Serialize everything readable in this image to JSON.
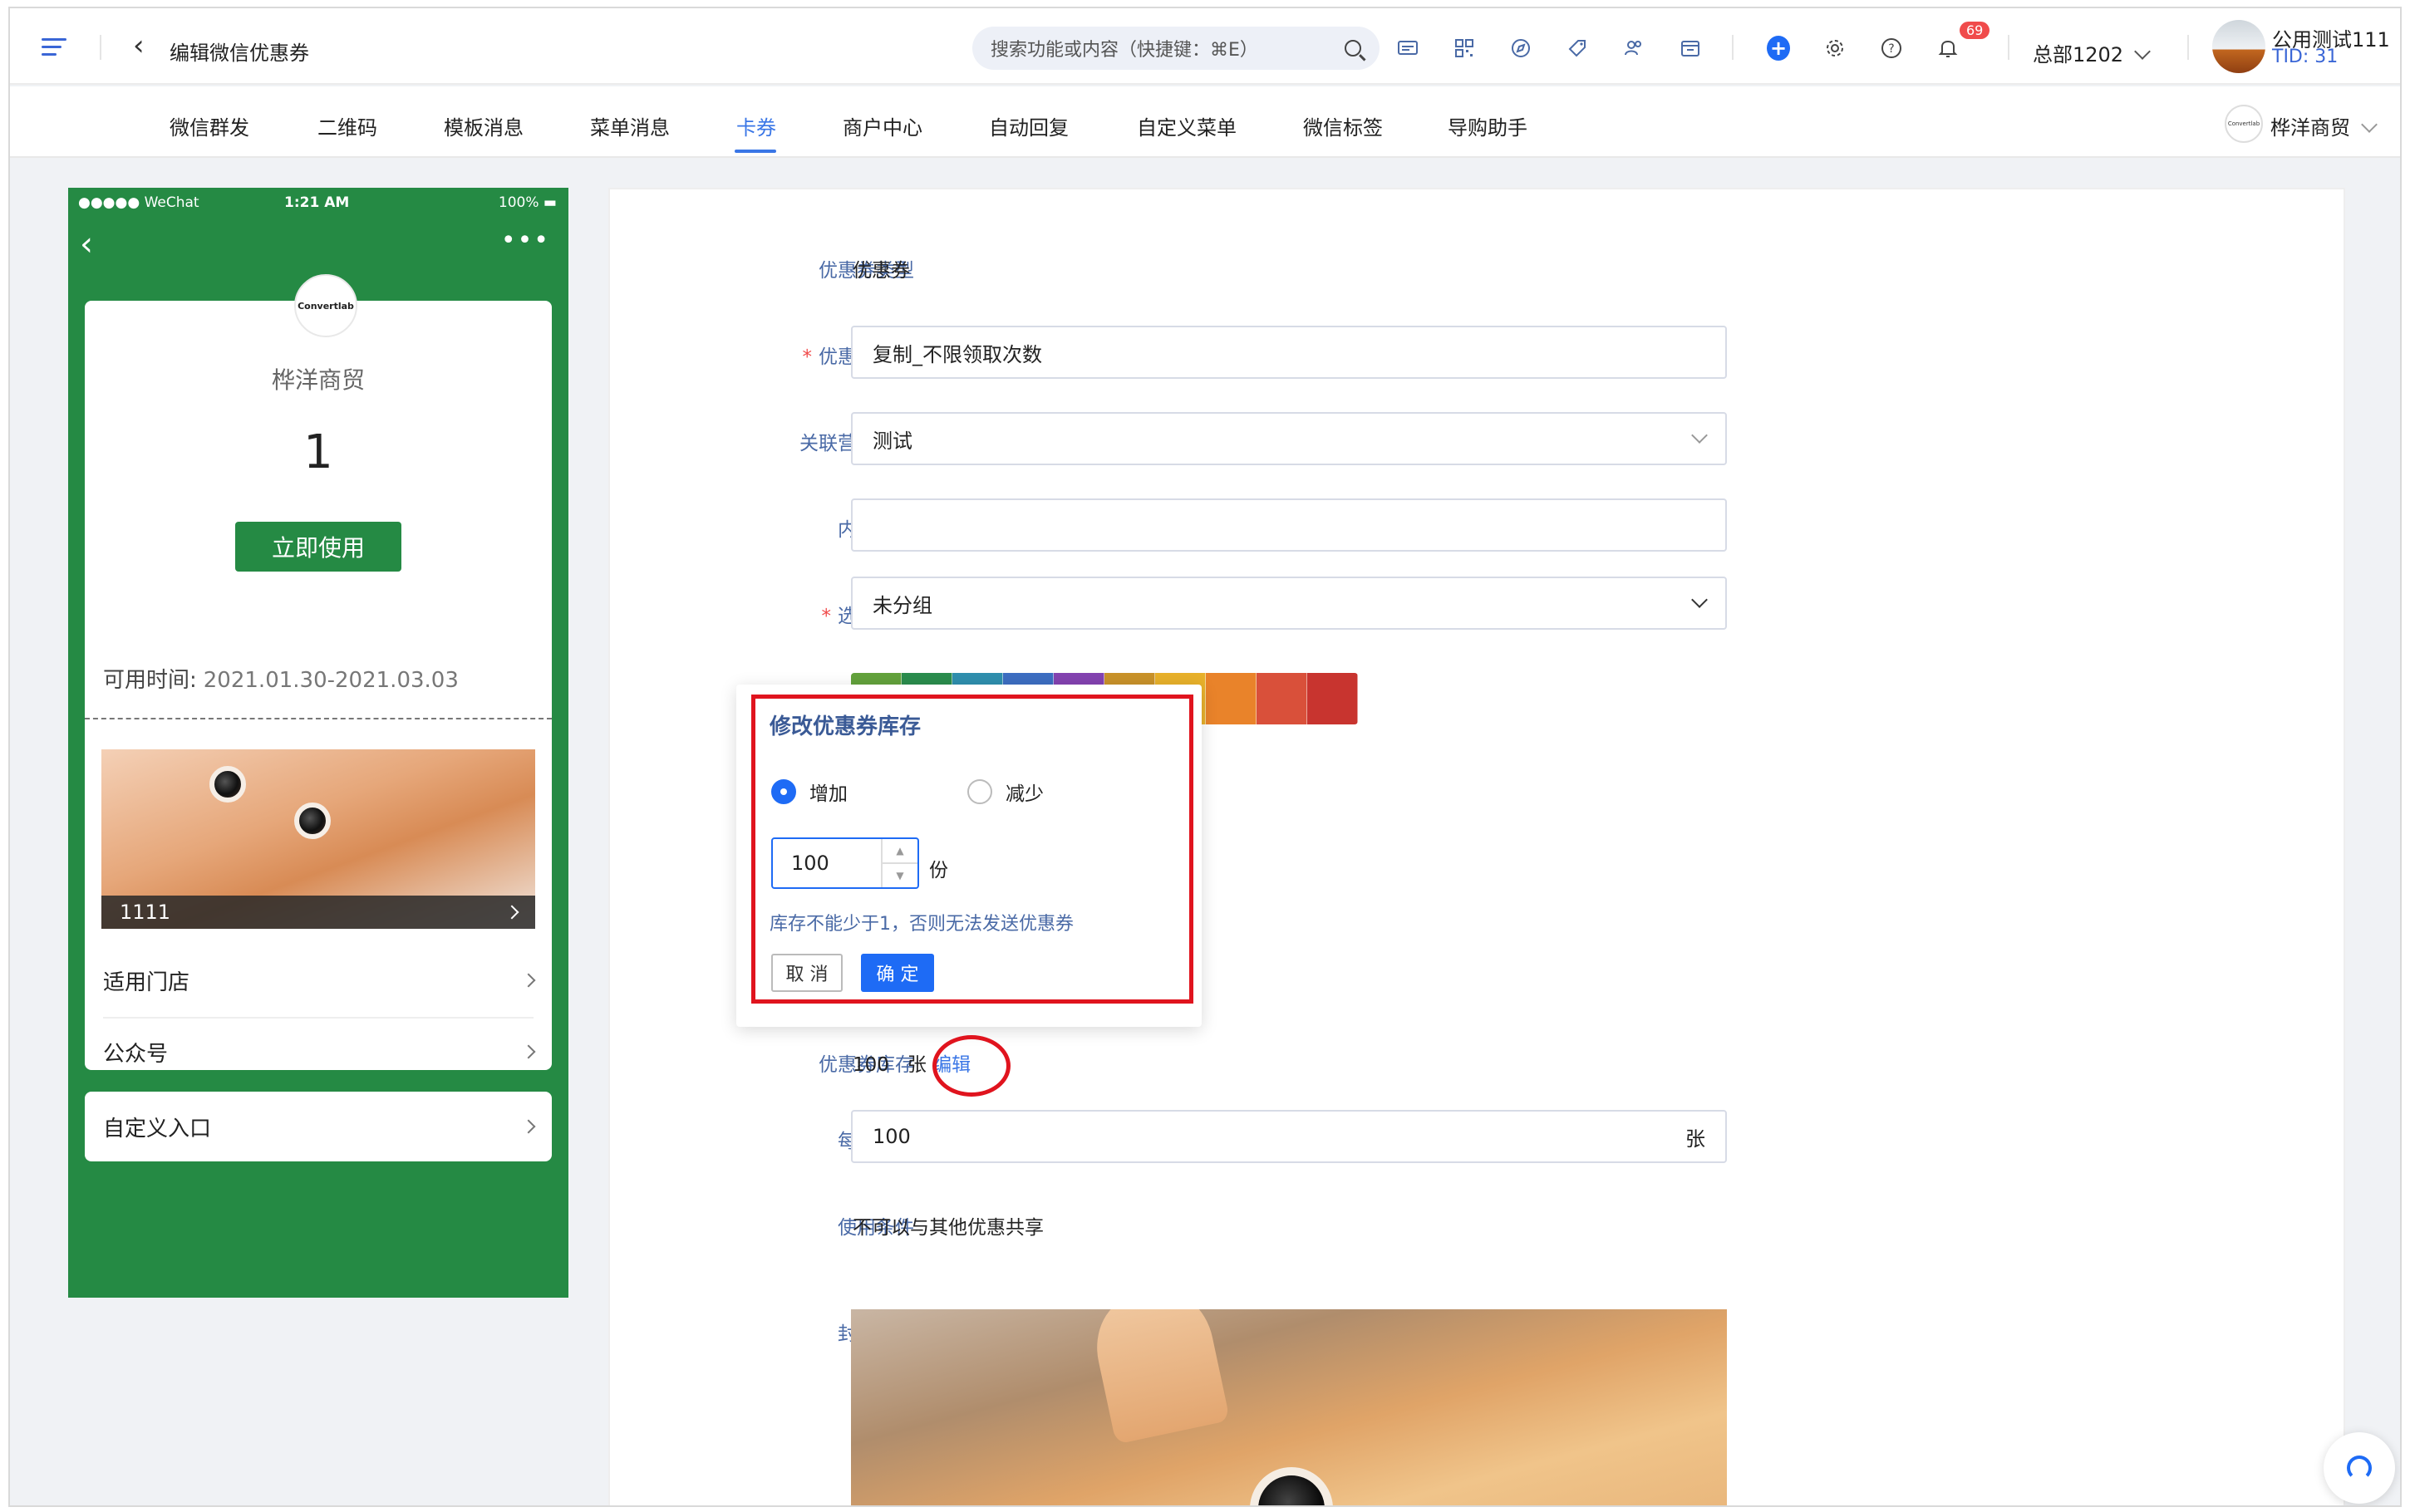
{
  "header": {
    "title": "编辑微信优惠券",
    "search_placeholder": "搜索功能或内容（快捷键：⌘E）",
    "notification_count": "69",
    "org": "总部1202",
    "user_name": "公用测试111",
    "user_tid": "TID: 31"
  },
  "nav": {
    "items": [
      "微信群发",
      "二维码",
      "模板消息",
      "菜单消息",
      "卡券",
      "商户中心",
      "自动回复",
      "自定义菜单",
      "微信标签",
      "导购助手"
    ],
    "active": "卡券",
    "shop_logo_text": "Convertlab",
    "shop_name": "桦洋商贸"
  },
  "phone": {
    "carrier": "●●●●● WeChat",
    "time": "1:21 AM",
    "battery": "100%",
    "logo_text": "Convertlab",
    "merchant": "桦洋商贸",
    "value": "1",
    "use_button": "立即使用",
    "date_label": "可用时间:",
    "date_value": "2021.01.30-2021.03.03",
    "image_caption": "1111",
    "rows": [
      "适用门店",
      "公众号"
    ],
    "custom_entry": "自定义入口"
  },
  "form": {
    "coupon_type_label": "优惠券类型",
    "coupon_type_value": "优惠券",
    "name_label": "优惠券名称",
    "name_value": "复制_不限领取次数",
    "activity_label": "关联营销活动",
    "activity_value": "测试",
    "tag_label": "内容标签",
    "tag_value": "",
    "group_label": "选择分组",
    "group_value": "未分组",
    "color_label_partial": "*",
    "partial_label": "优",
    "stock_label": "优惠券库存",
    "stock_value": "100",
    "stock_unit": "张",
    "stock_edit": "编辑",
    "limit_label": "每人限领",
    "limit_value": "100",
    "limit_unit": "张",
    "condition_label": "使用条件",
    "condition_value": "不可以与其他优惠共享",
    "cover_label": "封面图片"
  },
  "palette": [
    "#63a23c",
    "#2b8d4e",
    "#2f8fae",
    "#3d6ec2",
    "#8443b1",
    "#c9922a",
    "#e8b12b",
    "#e9832a",
    "#d9503a",
    "#c8342f"
  ],
  "modal": {
    "title": "修改优惠券库存",
    "option_increase": "增加",
    "option_decrease": "减少",
    "selected": "增加",
    "amount": "100",
    "unit": "份",
    "hint": "库存不能少于1，否则无法发送优惠券",
    "cancel": "取 消",
    "confirm": "确 定"
  },
  "colors": {
    "accent": "#1e6bf5",
    "highlight": "#e0141e",
    "phone_green": "#258a44"
  }
}
